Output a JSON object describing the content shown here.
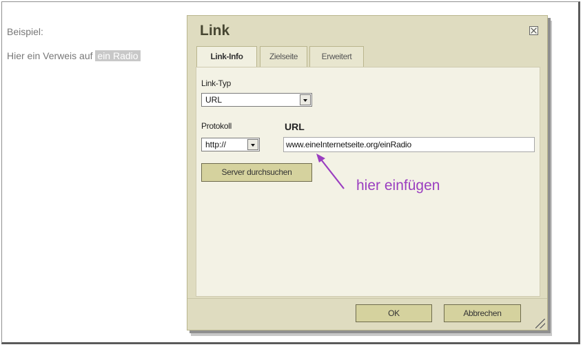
{
  "editor": {
    "line1": "Beispiel:",
    "line2_prefix": "Hier ein Verweis auf ",
    "line2_selected": "ein Radio"
  },
  "dialog": {
    "title": "Link",
    "tabs": [
      {
        "label": "Link-Info",
        "active": true
      },
      {
        "label": "Zielseite",
        "active": false
      },
      {
        "label": "Erweitert",
        "active": false
      }
    ],
    "link_type_label": "Link-Typ",
    "link_type_value": "URL",
    "protocol_label": "Protokoll",
    "protocol_value": "http://",
    "url_label": "URL",
    "url_value": "www.eineInternetseite.org/einRadio",
    "browse_button": "Server durchsuchen",
    "ok_button": "OK",
    "cancel_button": "Abbrechen"
  },
  "annotation": {
    "text": "hier einfügen",
    "color": "#9a3ec0"
  },
  "colors": {
    "dialog_bg": "#dfdcc0",
    "panel_bg": "#f3f2e5",
    "button_bg": "#d5d29e"
  }
}
